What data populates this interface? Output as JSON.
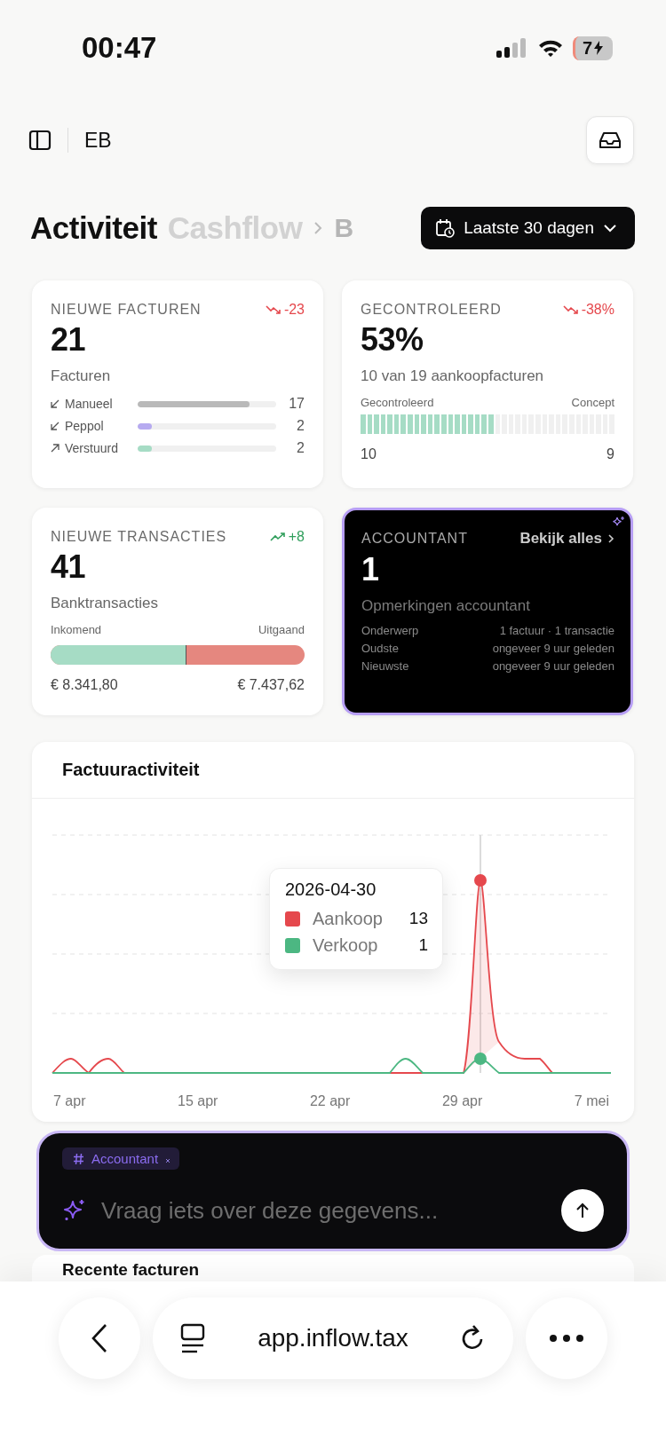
{
  "status_bar": {
    "time": "00:47",
    "battery": "7"
  },
  "header": {
    "workspace": "EB"
  },
  "tabs": [
    {
      "label": "Activiteit",
      "selected": true
    },
    {
      "label": "Cashflow",
      "selected": false
    },
    {
      "label": "B",
      "selected": false
    }
  ],
  "date_filter": {
    "label": "Laatste 30 dagen"
  },
  "invoices_card": {
    "title": "NIEUWE FACTUREN",
    "trend": "-23",
    "trend_falling": true,
    "value": "21",
    "caption": "Facturen",
    "rows": [
      {
        "kind": "in",
        "label": "Manueel",
        "count": "17",
        "level": 0.81,
        "color": "#b9b9b9"
      },
      {
        "kind": "in",
        "label": "Peppol",
        "count": "2",
        "level": 0.1,
        "color": "#b6aaf0"
      },
      {
        "kind": "out",
        "label": "Verstuurd",
        "count": "2",
        "level": 0.1,
        "color": "#a6dcc5"
      }
    ]
  },
  "checked_card": {
    "title": "GECONTROLEERD",
    "trend": "-38%",
    "trend_falling": true,
    "value": "53%",
    "caption": "10 van 19 aankoopfacturen",
    "left_label": "Gecontroleerd",
    "right_label": "Concept",
    "level": 0.53,
    "left_count": "10",
    "right_count": "9"
  },
  "transactions_card": {
    "title": "NIEUWE TRANSACTIES",
    "trend": "+8",
    "trend_falling": false,
    "value": "41",
    "caption": "Banktransacties",
    "left_label": "Inkomend",
    "right_label": "Uitgaand",
    "level": 0.53,
    "left_amount": "€ 8.341,80",
    "right_amount": "€ 7.437,62"
  },
  "accountant_card": {
    "title": "ACCOUNTANT",
    "link": "Bekijk alles",
    "value": "1",
    "caption": "Opmerkingen accountant",
    "rows": [
      {
        "label": "Onderwerp",
        "value": "1 factuur · 1 transactie"
      },
      {
        "label": "Oudste",
        "value": "ongeveer 9 uur geleden"
      },
      {
        "label": "Nieuwste",
        "value": "ongeveer 9 uur geleden"
      }
    ]
  },
  "activity_chart": {
    "title": "Factuuractiviteit",
    "x_labels": [
      "7 apr",
      "15 apr",
      "22 apr",
      "29 apr",
      "7 mei"
    ],
    "tooltip": {
      "date": "2026-04-30",
      "items": [
        {
          "name": "Aankoop",
          "value": "13",
          "color": "#e5484d"
        },
        {
          "name": "Verkoop",
          "value": "1",
          "color": "#4cb782"
        }
      ]
    }
  },
  "composer": {
    "tag": "Accountant",
    "placeholder": "Vraag iets over deze gegevens..."
  },
  "recent_invoices": {
    "title": "Recente facturen"
  },
  "browser": {
    "url": "app.inflow.tax"
  }
}
